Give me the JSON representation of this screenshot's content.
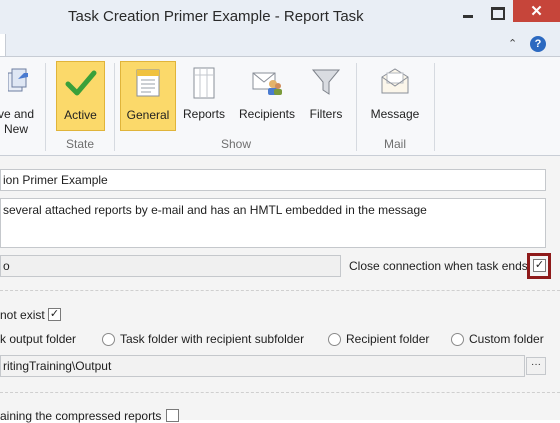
{
  "window": {
    "title": "Task Creation Primer Example - Report Task",
    "close_glyph": "✕"
  },
  "tabbar": {
    "collapse_glyph": "⌃",
    "help_glyph": "?"
  },
  "ribbon": {
    "save_new_label_line1": "ve and",
    "save_new_label_line2": "New",
    "active_label": "Active",
    "state_group": "State",
    "general_label": "General",
    "reports_label": "Reports",
    "recipients_label": "Recipients",
    "filters_label": "Filters",
    "show_group": "Show",
    "message_label": "Message",
    "mail_group": "Mail"
  },
  "form": {
    "name_value": "ion Primer Example",
    "description_value": "several attached reports by e-mail and has an HMTL embedded in the message",
    "connection_value": "o",
    "close_connection_label": "Close connection when task ends",
    "close_connection_checked": "✓",
    "create_folder_label": "not exist",
    "create_folder_checked": "✓",
    "option_task_output": "k output folder",
    "option_task_recipient_sub": "Task folder with recipient subfolder",
    "option_recipient_folder": "Recipient folder",
    "option_custom_folder": "Custom folder",
    "output_path": "ritingTraining\\Output",
    "browse_glyph": "···",
    "compressed_label": "aining the compressed reports"
  }
}
